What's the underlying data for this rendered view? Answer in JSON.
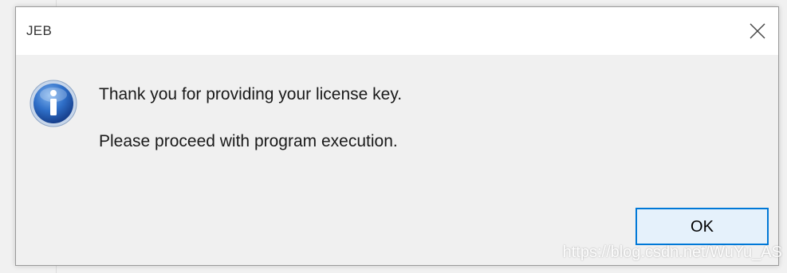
{
  "dialog": {
    "title": "JEB",
    "message_line1": "Thank you for providing your license key.",
    "message_line2": "Please proceed with program execution.",
    "ok_label": "OK",
    "icons": {
      "close": "close-icon",
      "info": "info-icon"
    }
  },
  "watermark": {
    "text": "https://blog.csdn.net/WuYu_AS"
  },
  "colors": {
    "accent": "#0078d7",
    "button_bg": "#e5f1fb",
    "dialog_bg": "#f0f0f0",
    "titlebar_bg": "#ffffff",
    "info_blue": "#1f5fb6"
  }
}
